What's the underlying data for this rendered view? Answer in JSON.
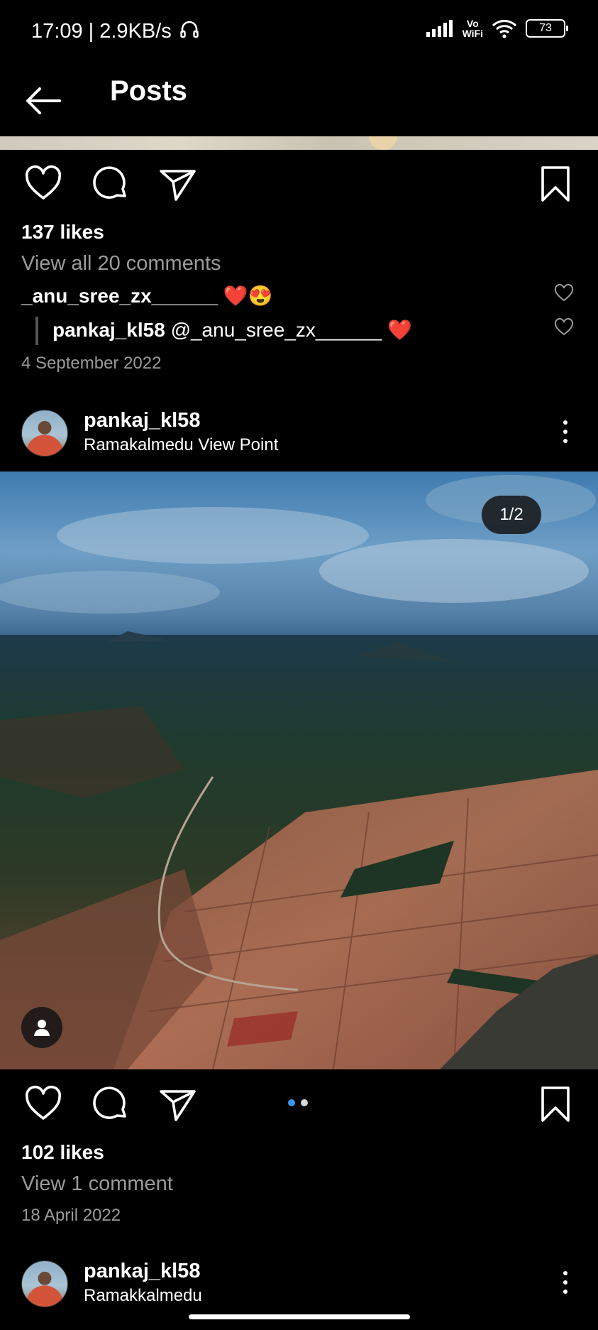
{
  "status_bar": {
    "time_speed": "17:09 | 2.9KB/s",
    "vo_wifi": "Vo\nWiFi",
    "battery": "73"
  },
  "header": {
    "title": "Posts"
  },
  "post1": {
    "likes": "137 likes",
    "view_comments": "View all 20 comments",
    "comment_user": "_anu_sree_zx______",
    "comment_emoji": "❤️😍",
    "reply_user": "pankaj_kl58",
    "reply_text": "@_anu_sree_zx______",
    "reply_emoji": "❤️",
    "date": "4 September 2022"
  },
  "post2": {
    "username": "pankaj_kl58",
    "location": "Ramakalmedu View Point",
    "image_counter": "1/2",
    "likes": "102 likes",
    "view_comments": "View 1 comment",
    "date": "18 April 2022",
    "carousel_active_color": "#3897f0"
  },
  "post3": {
    "username": "pankaj_kl58",
    "location": "Ramakkalmedu"
  },
  "icons": {
    "back": "arrow-left-icon",
    "like": "heart-icon",
    "comment": "comment-bubble-icon",
    "share": "send-icon",
    "save": "bookmark-icon",
    "more": "more-vertical-icon",
    "tag": "person-tag-icon"
  }
}
